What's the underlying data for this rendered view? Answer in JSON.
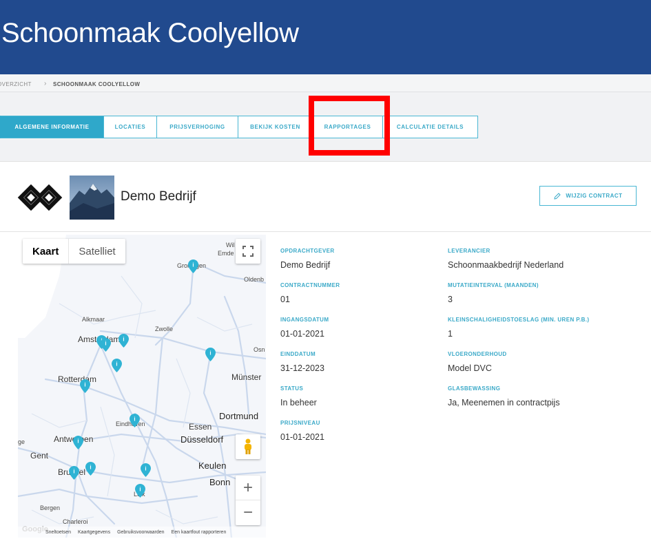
{
  "header": {
    "title": "Schoonmaak Coolyellow"
  },
  "breadcrumb": {
    "items": [
      "OVERZICHT",
      "SCHOONMAAK COOLYELLOW"
    ]
  },
  "tabs": [
    {
      "label": "ALGEMENE INFORMATIE",
      "active": true
    },
    {
      "label": "LOCATIES",
      "active": false
    },
    {
      "label": "PRIJSVERHOGING",
      "active": false
    },
    {
      "label": "BEKIJK KOSTEN",
      "active": false
    },
    {
      "label": "RAPPORTAGES",
      "active": false
    },
    {
      "label": "CALCULATIE DETAILS",
      "active": false
    }
  ],
  "company": {
    "name": "Demo Bedrijf"
  },
  "edit_button": {
    "label": "WIJZIG CONTRACT",
    "icon": "pencil-icon"
  },
  "map": {
    "toggle": {
      "map": "Kaart",
      "satellite": "Satelliet"
    },
    "labels": [
      "Wil",
      "Emde",
      "Groningen",
      "Oldenb",
      "Alkmaar",
      "Amsterdam",
      "Zwolle",
      "Osn",
      "Rotterdam",
      "Münster",
      "Dortmund",
      "Essen",
      "Eindhoven",
      "Antwerpen",
      "Düsseldorf",
      "Gent",
      "Brussel",
      "Keulen",
      "Bonn",
      "Luik",
      "Bergen",
      "Charleroi",
      "ge"
    ],
    "attribution": [
      "Sneltoetsen",
      "Kaartgegevens",
      "Gebruiksvoorwaarden",
      "Een kaartfout rapporteren"
    ],
    "google": "Google",
    "zoom_in": "+",
    "zoom_out": "−"
  },
  "details": {
    "left": [
      {
        "label": "OPDRACHTGEVER",
        "value": "Demo Bedrijf"
      },
      {
        "label": "CONTRACTNUMMER",
        "value": "01"
      },
      {
        "label": "INGANGSDATUM",
        "value": "01-01-2021"
      },
      {
        "label": "EINDDATUM",
        "value": "31-12-2023"
      },
      {
        "label": "STATUS",
        "value": "In beheer"
      },
      {
        "label": "PRIJSNIVEAU",
        "value": "01-01-2021"
      }
    ],
    "right": [
      {
        "label": "LEVERANCIER",
        "value": "Schoonmaakbedrijf Nederland"
      },
      {
        "label": "MUTATIEINTERVAL (MAANDEN)",
        "value": "3"
      },
      {
        "label": "KLEINSCHALIGHEIDSTOESLAG (MIN. UREN P.B.)",
        "value": "1"
      },
      {
        "label": "VLOERONDERHOUD",
        "value": "Model DVC"
      },
      {
        "label": "GLASBEWASSING",
        "value": "Ja, Meenemen in contractpijs"
      }
    ]
  },
  "colors": {
    "header": "#214a8e",
    "accent": "#2fa8ca",
    "highlight": "#ff0000",
    "pin": "#2fb3d4"
  }
}
